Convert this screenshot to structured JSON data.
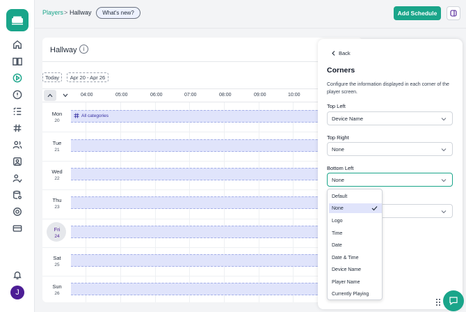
{
  "user": {
    "initial": "J"
  },
  "header": {
    "breadcrumb_root": "Players",
    "breadcrumb_sep": ">",
    "breadcrumb_current": "Hallway",
    "whats_new": "What's new?",
    "add_schedule": "Add Schedule"
  },
  "schedule": {
    "title": "Hallway",
    "today": "Today",
    "range": "Apr 20 - Apr 26",
    "hours": [
      "04:00",
      "05:00",
      "06:00",
      "07:00",
      "08:00",
      "09:00",
      "10:00"
    ],
    "days": [
      {
        "name": "Mon",
        "num": "20"
      },
      {
        "name": "Tue",
        "num": "21"
      },
      {
        "name": "Wed",
        "num": "22"
      },
      {
        "name": "Thu",
        "num": "23"
      },
      {
        "name": "Fri",
        "num": "24"
      },
      {
        "name": "Sat",
        "num": "25"
      },
      {
        "name": "Sun",
        "num": "26"
      }
    ],
    "event_label": "All categories"
  },
  "panel": {
    "back": "Back",
    "title": "Corners",
    "description": "Configure the information displayed in each corner of the player screen.",
    "top_left_label": "Top Left",
    "top_left_value": "Device Name",
    "top_right_label": "Top Right",
    "top_right_value": "None",
    "bottom_left_label": "Bottom Left",
    "bottom_left_value": "None",
    "options": [
      "Default",
      "None",
      "Logo",
      "Time",
      "Date",
      "Date & Time",
      "Device Name",
      "Player Name",
      "Currently Playing"
    ],
    "selected_option": "None"
  },
  "colors": {
    "brand": "#1aa58a",
    "event_band": "#e0e4fb",
    "avatar": "#4c1d95"
  }
}
